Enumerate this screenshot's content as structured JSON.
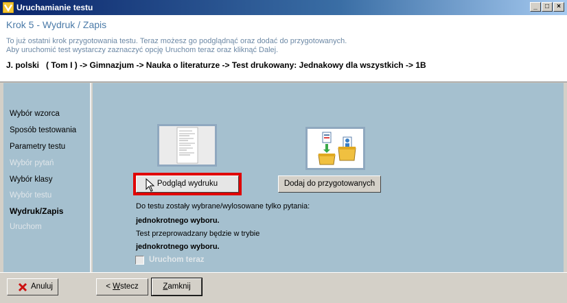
{
  "window": {
    "title": "Uruchamianie testu",
    "min": "_",
    "max": "□",
    "close": "×"
  },
  "header": {
    "step_title": "Krok 5 - Wydruk / Zapis",
    "desc_line1": "To już ostatni krok przygotowania testu. Teraz możesz go podglądnąć oraz dodać do przygotowanych.",
    "desc_line2": "Aby uruchomić test wystarczy zaznaczyć opcję Uruchom teraz oraz kliknąć Dalej.",
    "path": "J. polski   ( Tom I ) -> Gimnazjum -> Nauka o literaturze -> Test drukowany: Jednakowy dla wszystkich -> 1B"
  },
  "nav": {
    "items": [
      {
        "label": "Wybór wzorca",
        "state": "normal"
      },
      {
        "label": "Sposób testowania",
        "state": "normal"
      },
      {
        "label": "Parametry testu",
        "state": "normal"
      },
      {
        "label": "Wybór pytań",
        "state": "disabled"
      },
      {
        "label": "Wybór klasy",
        "state": "normal"
      },
      {
        "label": "Wybór testu",
        "state": "disabled"
      },
      {
        "label": "Wydruk/Zapis",
        "state": "active"
      },
      {
        "label": "Uruchom",
        "state": "disabled"
      }
    ]
  },
  "main": {
    "preview_button": "Podgląd wydruku",
    "add_button": "Dodaj do przygotowanych",
    "info_line1": "Do testu zostały wybrane/wylosowane tylko pytania:",
    "info_line2": "jednokrotnego wyboru.",
    "info_line3": "Test przeprowadzany będzie w trybie",
    "info_line4": "jednokrotnego wyboru.",
    "run_now_label": "Uruchom teraz",
    "run_now_checked": false
  },
  "footer": {
    "cancel": "Anuluj",
    "back_prefix": "< ",
    "back_accel": "W",
    "back_rest": "stecz",
    "close_accel": "Z",
    "close_rest": "amknij"
  },
  "colors": {
    "panel": "#a5c0cf",
    "highlight_frame": "#e00000",
    "title_accent": "#4a7aa8"
  }
}
